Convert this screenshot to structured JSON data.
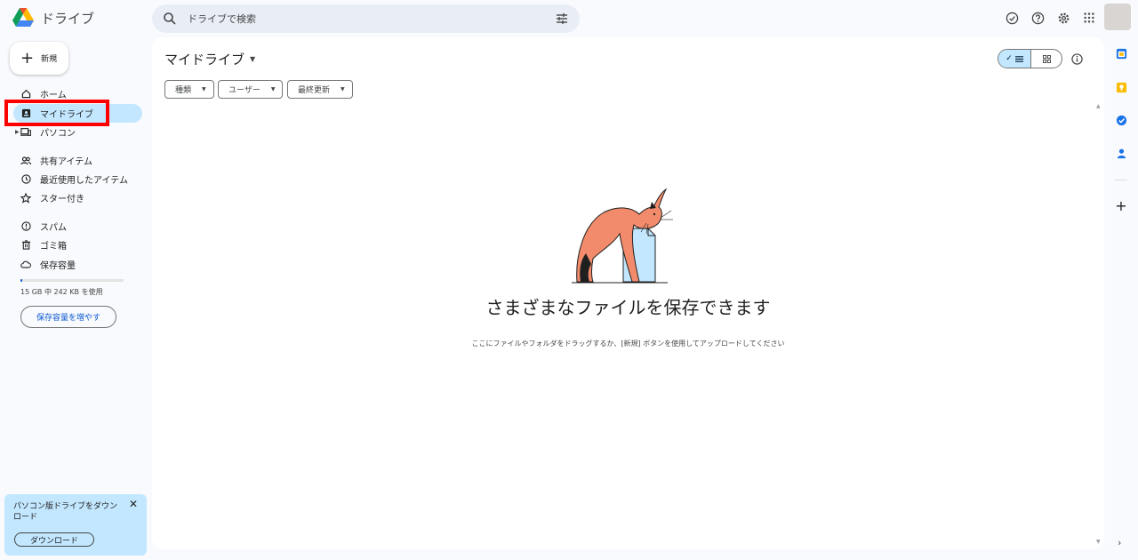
{
  "header": {
    "app_name": "ドライブ",
    "search_placeholder": "ドライブで検索"
  },
  "sidebar": {
    "new_label": "新規",
    "items": [
      {
        "label": "ホーム",
        "icon": "home-icon"
      },
      {
        "label": "マイドライブ",
        "icon": "my-drive-icon",
        "active": true
      },
      {
        "label": "パソコン",
        "icon": "computer-icon"
      },
      {
        "label": "共有アイテム",
        "icon": "shared-icon"
      },
      {
        "label": "最近使用したアイテム",
        "icon": "clock-icon"
      },
      {
        "label": "スター付き",
        "icon": "star-icon"
      },
      {
        "label": "スパム",
        "icon": "spam-icon"
      },
      {
        "label": "ゴミ箱",
        "icon": "trash-icon"
      },
      {
        "label": "保存容量",
        "icon": "cloud-icon"
      }
    ],
    "storage_text": "15 GB 中 242 KB を使用",
    "storage_used_fraction": 0.0,
    "more_storage": "保存容量を増やす",
    "promo_text": "パソコン版ドライブをダウンロード",
    "promo_button": "ダウンロード",
    "promo_close": "✕"
  },
  "main": {
    "title": "マイドライブ",
    "filters": [
      "種類",
      "ユーザー",
      "最終更新"
    ],
    "empty_title": "さまざまなファイルを保存できます",
    "empty_sub": "ここにファイルやフォルダをドラッグするか、[新規] ボタンを使用してアップロードしてください"
  },
  "colors": {
    "accent": "#0b57d0",
    "active_bg": "#c2e7ff",
    "highlight": "#ff0000",
    "cat": "#f28b6b"
  }
}
